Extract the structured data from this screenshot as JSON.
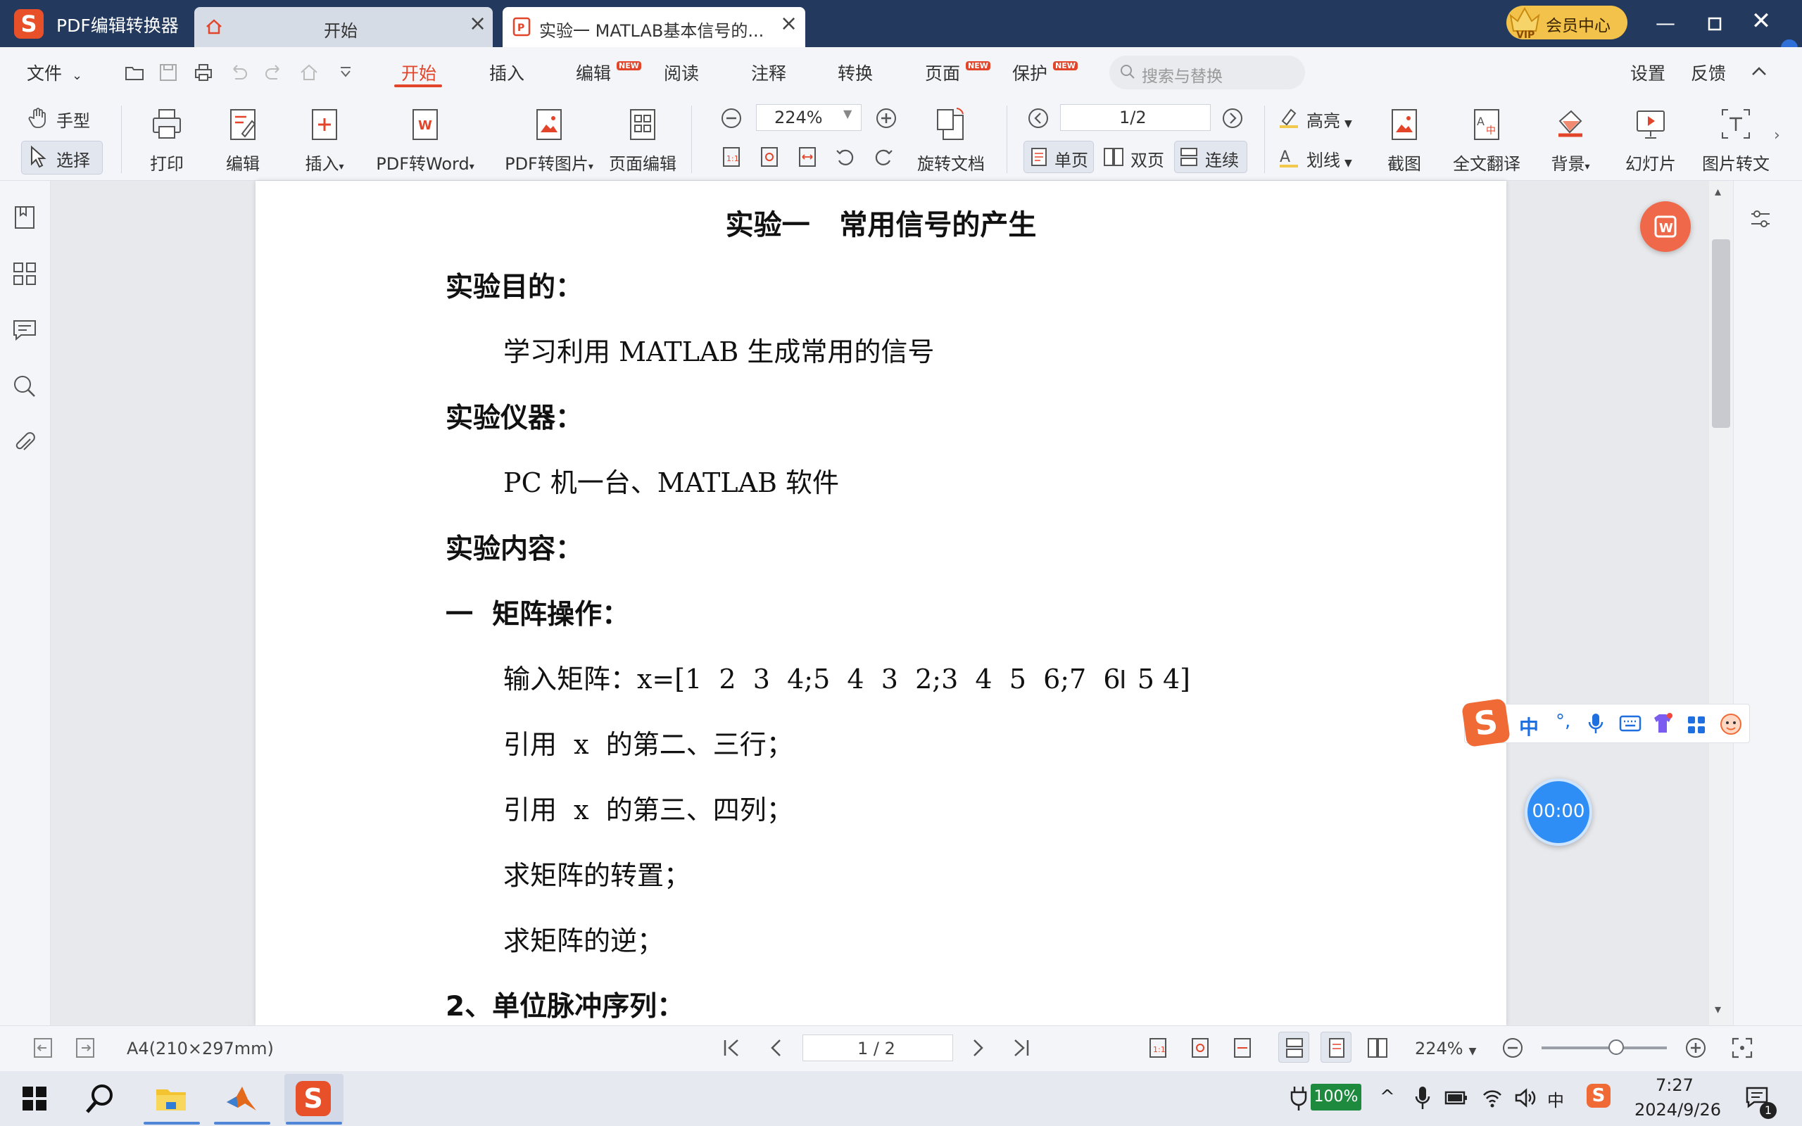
{
  "titlebar": {
    "app_name": "PDF编辑转换器",
    "tabs": [
      {
        "label": "开始"
      },
      {
        "label": "实验一 MATLAB基本信号的..."
      }
    ],
    "vip_label": "会员中心"
  },
  "menu": {
    "file": "文件",
    "items": [
      "开始",
      "插入",
      "编辑",
      "阅读",
      "注释",
      "转换",
      "页面",
      "保护"
    ],
    "new_badge": "NEW",
    "search_placeholder": "搜索与替换",
    "settings": "设置",
    "feedback": "反馈"
  },
  "ribbon": {
    "hand_tool": "手型",
    "select_tool": "选择",
    "print": "打印",
    "edit": "编辑",
    "insert": "插入",
    "pdf_to_word": "PDF转Word",
    "pdf_to_image": "PDF转图片",
    "page_edit": "页面编辑",
    "zoom": "224%",
    "page_indicator": "1/2",
    "rotate_doc": "旋转文档",
    "single_page": "单页",
    "double_page": "双页",
    "continuous": "连续",
    "highlight": "高亮",
    "underline": "划线",
    "screenshot": "截图",
    "translate": "全文翻译",
    "background": "背景",
    "slideshow": "幻灯片",
    "image_to_text": "图片转文"
  },
  "document": {
    "title": "实验一   常用信号的产生",
    "sections": [
      {
        "kind": "h",
        "text": "实验目的："
      },
      {
        "kind": "p",
        "text": "学习利用 MATLAB 生成常用的信号"
      },
      {
        "kind": "h",
        "text": "实验仪器："
      },
      {
        "kind": "p",
        "text": "PC 机一台、MATLAB 软件"
      },
      {
        "kind": "h",
        "text": "实验内容："
      },
      {
        "kind": "h",
        "text": "一  矩阵操作："
      },
      {
        "kind": "p",
        "text": "输入矩阵：x=[1  2  3  4;5  4  3  2;3  4  5  6;7  6  5 4]"
      },
      {
        "kind": "p",
        "text": "引用  x  的第二、三行；"
      },
      {
        "kind": "p",
        "text": "引用  x  的第三、四列；"
      },
      {
        "kind": "p",
        "text": "求矩阵的转置；"
      },
      {
        "kind": "p",
        "text": "求矩阵的逆；"
      },
      {
        "kind": "h",
        "text": "2、单位脉冲序列："
      }
    ]
  },
  "widgets": {
    "timer": "00:00",
    "ime_lang": "中"
  },
  "statusbar": {
    "paper_size": "A4(210×297mm)",
    "page": "1 / 2",
    "zoom": "224%"
  },
  "taskbar": {
    "battery": "100%",
    "ime": "中",
    "time": "7:27",
    "date": "2024/9/26",
    "notifications": "1"
  },
  "colors": {
    "titlebar": "#233a5e",
    "accent": "#e2452a",
    "brand": "#e8502a"
  }
}
